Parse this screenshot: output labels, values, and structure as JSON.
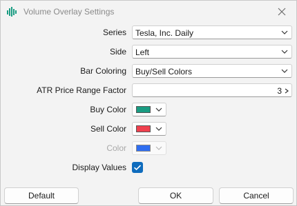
{
  "window": {
    "title": "Volume Overlay Settings",
    "app_icon": "volume-bars-icon"
  },
  "fields": {
    "series": {
      "label": "Series",
      "value": "Tesla, Inc. Daily"
    },
    "side": {
      "label": "Side",
      "value": "Left"
    },
    "bar_coloring": {
      "label": "Bar Coloring",
      "value": "Buy/Sell Colors"
    },
    "atr": {
      "label": "ATR Price Range Factor",
      "value": "3"
    },
    "buy_color": {
      "label": "Buy Color",
      "color": "#1a9c82"
    },
    "sell_color": {
      "label": "Sell Color",
      "color": "#f0404e"
    },
    "color": {
      "label": "Color",
      "color": "#2f6ef0",
      "disabled": true
    },
    "display_values": {
      "label": "Display Values",
      "checked": true
    }
  },
  "buttons": {
    "default": "Default",
    "ok": "OK",
    "cancel": "Cancel"
  }
}
